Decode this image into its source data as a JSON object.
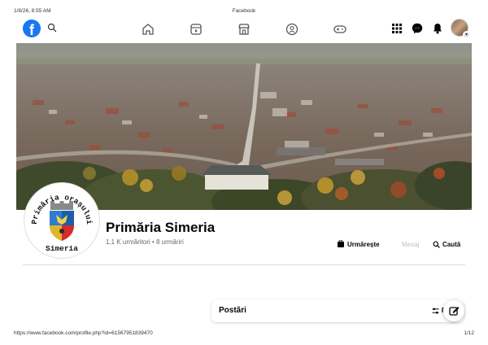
{
  "print": {
    "datetime": "1/8/26, 8:55 AM",
    "title": "Facebook",
    "url": "https://www.facebook.com/profile.php?id=61567951839470",
    "page": "1/12"
  },
  "nav": {
    "logo": "f",
    "center_icons": [
      "home-icon",
      "video-icon",
      "marketplace-icon",
      "groups-icon",
      "gaming-icon"
    ],
    "right_icons": [
      "menu-grid-icon",
      "messenger-icon",
      "notifications-icon"
    ]
  },
  "profile": {
    "name": "Primăria Simeria",
    "followers": "1,1 K urmăritori",
    "separator": "•",
    "following": "8 urmăriri",
    "logo_arc_text": "Primăria orașului",
    "logo_bottom_text": "Simeria"
  },
  "actions": {
    "follow": "Urmărește",
    "message": "Mesaj",
    "search": "Caută"
  },
  "posts": {
    "title": "Postări",
    "filter": "Fi"
  },
  "colors": {
    "brand": "#1877f2",
    "text_secondary": "#65676b",
    "disabled": "#bcc0c4"
  }
}
